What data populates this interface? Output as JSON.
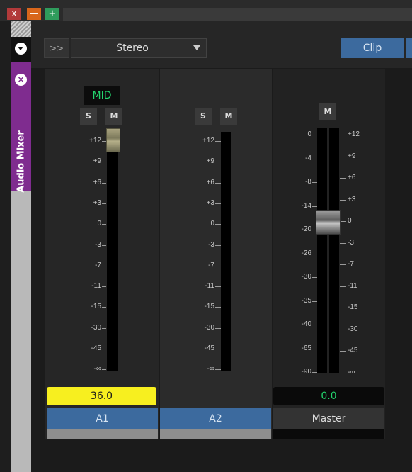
{
  "window": {
    "buttons": {
      "close": "x",
      "minimize": "—",
      "maximize": "+"
    }
  },
  "sidebar": {
    "panel_label": "Audio Mixer",
    "icons": [
      "dropdown-circle-icon",
      "close-circle-icon"
    ]
  },
  "toolbar": {
    "expand_label": ">>",
    "channel_mode": "Stereo",
    "clip_label": "Clip"
  },
  "colors": {
    "accent_blue": "#3c6a9e",
    "panel_purple": "#7f2c8f",
    "value_yellow": "#f7ef1f",
    "led_green": "#23d36d"
  },
  "channels": [
    {
      "name": "A1",
      "mode_badge": "MID",
      "solo": "S",
      "mute": "M",
      "value": "36.0",
      "scale": [
        "+12",
        "+9",
        "+6",
        "+3",
        "0",
        "-3",
        "-7",
        "-11",
        "-15",
        "-30",
        "-45",
        "-∞"
      ],
      "fader_at_mark": "+12"
    },
    {
      "name": "A2",
      "solo": "S",
      "mute": "M",
      "value": "",
      "scale": [
        "+12",
        "+9",
        "+6",
        "+3",
        "0",
        "-3",
        "-7",
        "-11",
        "-15",
        "-30",
        "-45",
        "-∞"
      ]
    },
    {
      "name": "Master",
      "mute": "M",
      "value": "0.0",
      "left_scale": [
        "0",
        "-4",
        "-8",
        "-14",
        "-20",
        "-26",
        "-30",
        "-35",
        "-40",
        "-65",
        "-90"
      ],
      "right_scale": [
        "+12",
        "+9",
        "+6",
        "+3",
        "0",
        "-3",
        "-7",
        "-11",
        "-15",
        "-30",
        "-45",
        "-∞"
      ],
      "fader_at_mark": "0"
    }
  ]
}
